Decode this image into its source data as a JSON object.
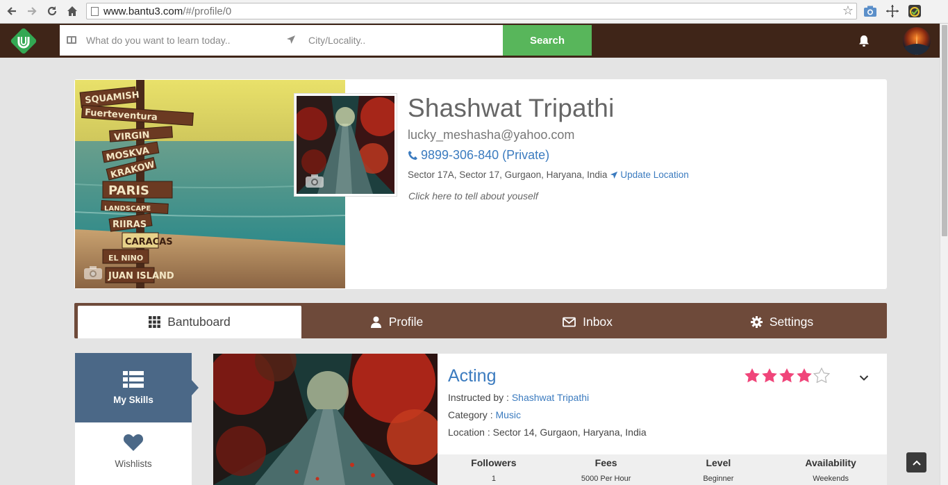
{
  "browser": {
    "url_host": "www.bantu3.com",
    "url_path": "/#/profile/0"
  },
  "header": {
    "search_placeholder": "What do you want to learn today..",
    "city_placeholder": "City/Locality..",
    "search_label": "Search"
  },
  "profile": {
    "name": "Shashwat Tripathi",
    "email": "lucky_meshasha@yahoo.com",
    "phone": "9899-306-840 (Private)",
    "address": "Sector 17A, Sector 17, Gurgaon, Haryana, India",
    "update_location": "Update Location",
    "about_prompt": "Click here to tell about youself"
  },
  "tabs": [
    {
      "label": "Bantuboard",
      "icon": "grid-icon"
    },
    {
      "label": "Profile",
      "icon": "user-icon"
    },
    {
      "label": "Inbox",
      "icon": "envelope-icon"
    },
    {
      "label": "Settings",
      "icon": "gear-icon"
    }
  ],
  "sidebar": {
    "items": [
      {
        "label": "My Skills",
        "icon": "list-icon"
      },
      {
        "label": "Wishlists",
        "icon": "heart-icon"
      }
    ]
  },
  "skill": {
    "title": "Acting",
    "instructor_label": "Instructed by : ",
    "instructor": "Shashwat Tripathi",
    "category_label": "Category : ",
    "category": "Music",
    "location_label": "Location : ",
    "location": "Sector 14, Gurgaon, Haryana, India",
    "rating": 4,
    "rating_max": 5,
    "stats": [
      {
        "label": "Followers",
        "value": "1"
      },
      {
        "label": "Fees",
        "value": "5000 Per Hour"
      },
      {
        "label": "Level",
        "value": "Beginner"
      },
      {
        "label": "Availability",
        "value": "Weekends"
      }
    ]
  },
  "colors": {
    "appbar": "#3f2518",
    "tabbar": "#6e4a3a",
    "search_button": "#58b65b",
    "sidebar_active": "#4b6887",
    "link": "#3b7bbf",
    "star": "#f0457a"
  }
}
